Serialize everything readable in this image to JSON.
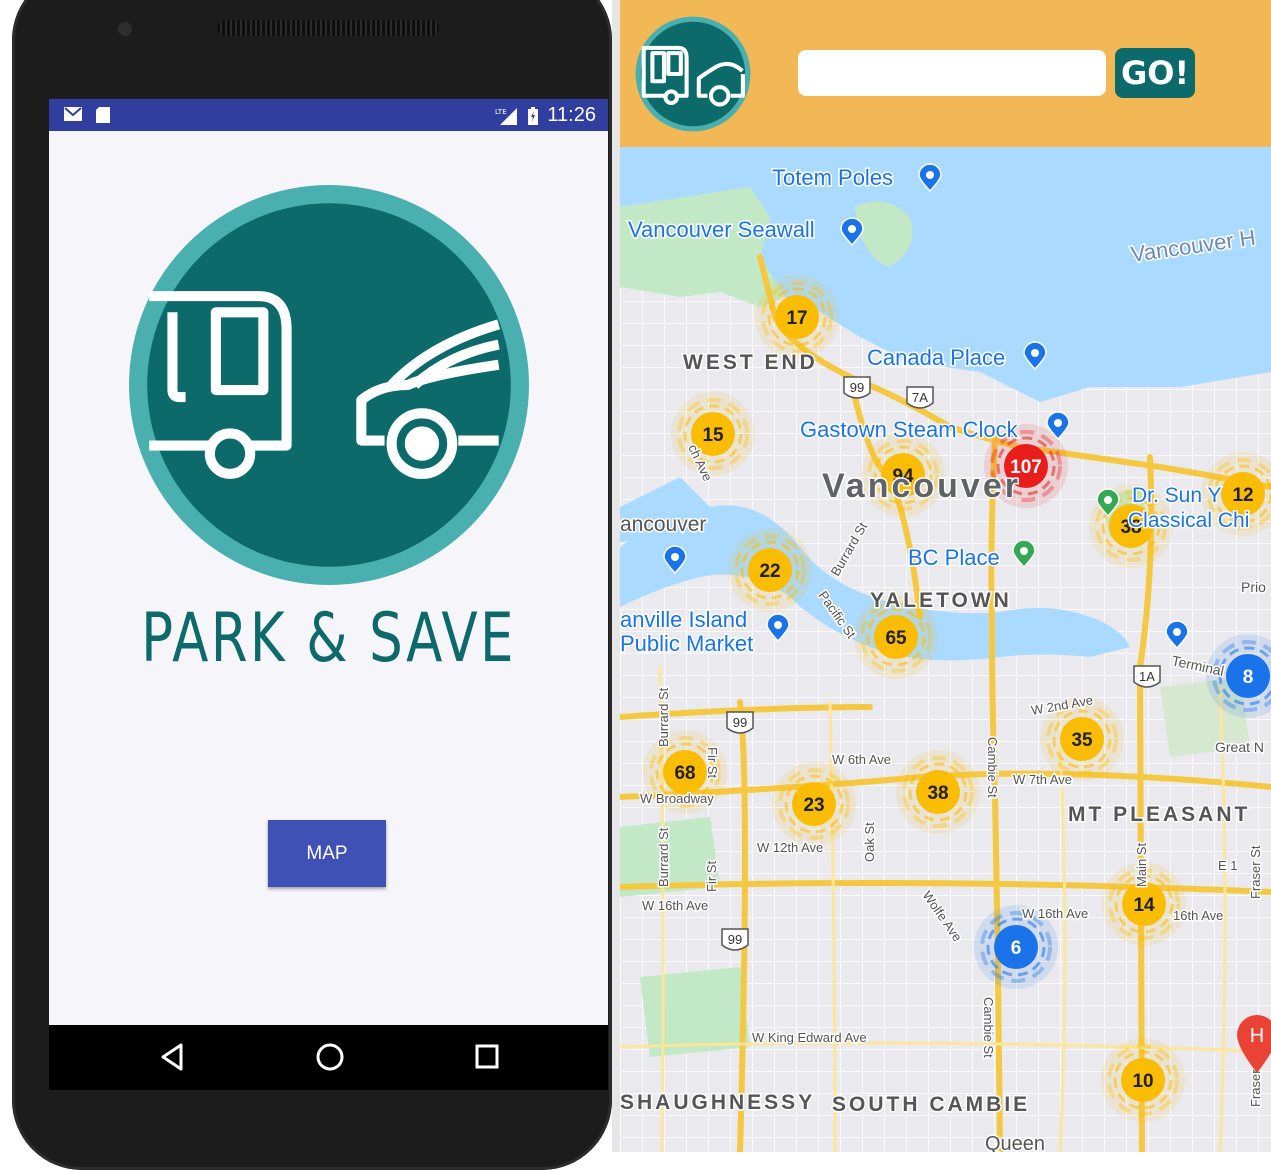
{
  "phone": {
    "status_bar": {
      "network": "LTE",
      "time": "11:26"
    },
    "app_title": "PARK & SAVE",
    "map_button_label": "MAP",
    "nav": [
      "back-icon",
      "home-icon",
      "recents-icon"
    ]
  },
  "app": {
    "search_placeholder": "",
    "go_label": "GO!",
    "map": {
      "labels": [
        {
          "text": "Totem Poles"
        },
        {
          "text": "Vancouver Seawall"
        },
        {
          "text": "Vancouver H"
        },
        {
          "text": "WEST END"
        },
        {
          "text": "Canada Place"
        },
        {
          "text": "Gastown Steam Clock"
        },
        {
          "text": "Vancouver"
        },
        {
          "text": "Dr. Sun Y"
        },
        {
          "text": "Classical Chi"
        },
        {
          "text": "ancouver"
        },
        {
          "text": "BC Place"
        },
        {
          "text": "YALETOWN"
        },
        {
          "text": "anville Island"
        },
        {
          "text": "Public Market"
        },
        {
          "text": "MT PLEASANT"
        },
        {
          "text": "SHAUGHNESSY"
        },
        {
          "text": "SOUTH CAMBIE"
        },
        {
          "text": "Queen"
        },
        {
          "text": "Prio"
        },
        {
          "text": "Terminal"
        },
        {
          "text": "Great N"
        }
      ],
      "streets": [
        {
          "text": "W 2nd Ave"
        },
        {
          "text": "W 6th Ave"
        },
        {
          "text": "W 7th Ave"
        },
        {
          "text": "W Broadway"
        },
        {
          "text": "W 12th Ave"
        },
        {
          "text": "W 16th Ave"
        },
        {
          "text": "W 16th Ave"
        },
        {
          "text": "16th Ave"
        },
        {
          "text": "W King Edward Ave"
        },
        {
          "text": "Burrard St"
        },
        {
          "text": "Burrard St"
        },
        {
          "text": "Burrard St"
        },
        {
          "text": "Pacific St"
        },
        {
          "text": "Cambie St"
        },
        {
          "text": "Cambie St"
        },
        {
          "text": "Oak St"
        },
        {
          "text": "Fir St"
        },
        {
          "text": "Fir St"
        },
        {
          "text": "Main St"
        },
        {
          "text": "Wolfe Ave"
        },
        {
          "text": "Fraser St"
        },
        {
          "text": "Fraser"
        },
        {
          "text": "E 1"
        },
        {
          "text": "ch Ave"
        }
      ],
      "highways": [
        "99",
        "7A",
        "99",
        "1A",
        "99"
      ],
      "clusters": [
        {
          "count": "17",
          "color": "#fbbc04"
        },
        {
          "count": "15",
          "color": "#fbbc04"
        },
        {
          "count": "94",
          "color": "#fbbc04"
        },
        {
          "count": "107",
          "color": "#ea1d1d"
        },
        {
          "count": "12",
          "color": "#fbbc04"
        },
        {
          "count": "38",
          "color": "#fbbc04"
        },
        {
          "count": "22",
          "color": "#fbbc04"
        },
        {
          "count": "65",
          "color": "#fbbc04"
        },
        {
          "count": "8",
          "color": "#1a73e8"
        },
        {
          "count": "35",
          "color": "#fbbc04"
        },
        {
          "count": "68",
          "color": "#fbbc04"
        },
        {
          "count": "23",
          "color": "#fbbc04"
        },
        {
          "count": "38",
          "color": "#fbbc04"
        },
        {
          "count": "14",
          "color": "#fbbc04"
        },
        {
          "count": "6",
          "color": "#1a73e8"
        },
        {
          "count": "10",
          "color": "#fbbc04"
        }
      ],
      "marker_letter": "H",
      "poi_icons": [
        "camera-icon",
        "camera-icon",
        "camera-icon",
        "camera-icon",
        "tree-icon",
        "shopping-icon",
        "government-icon",
        "train-icon",
        "stadium-icon"
      ]
    }
  },
  "colors": {
    "teal": "#0d6a6a",
    "teal_ring": "#4aafaf",
    "header": "#f2b856",
    "android_blue": "#303f9f",
    "button": "#3f51b5"
  }
}
